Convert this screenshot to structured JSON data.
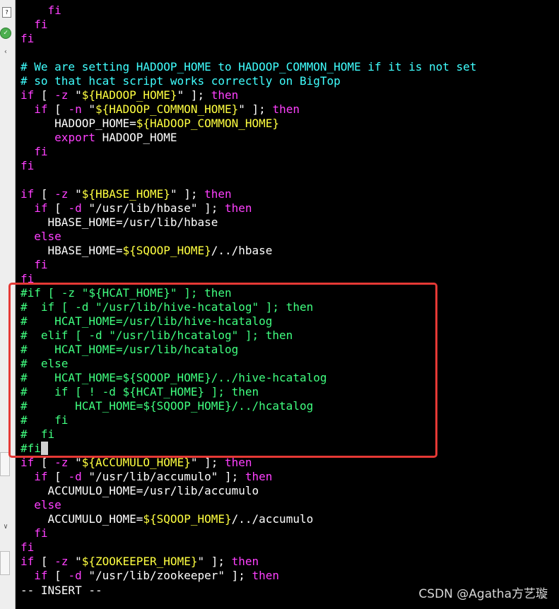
{
  "editor": {
    "mode_indicator": "-- INSERT --",
    "lines": [
      {
        "indent": "    ",
        "parts": [
          {
            "cls": "kw",
            "text": "fi"
          }
        ]
      },
      {
        "indent": "  ",
        "parts": [
          {
            "cls": "kw",
            "text": "fi"
          }
        ]
      },
      {
        "indent": "",
        "parts": [
          {
            "cls": "kw",
            "text": "fi"
          }
        ]
      },
      {
        "indent": "",
        "parts": []
      },
      {
        "indent": "",
        "parts": [
          {
            "cls": "comment",
            "text": "# We are setting HADOOP_HOME to HADOOP_COMMON_HOME if it is not set"
          }
        ]
      },
      {
        "indent": "",
        "parts": [
          {
            "cls": "comment",
            "text": "# so that hcat script works correctly on BigTop"
          }
        ]
      },
      {
        "indent": "",
        "parts": [
          {
            "cls": "kw",
            "text": "if"
          },
          {
            "cls": "code",
            "text": " [ "
          },
          {
            "cls": "kw",
            "text": "-z"
          },
          {
            "cls": "code",
            "text": " \""
          },
          {
            "cls": "var",
            "text": "${HADOOP_HOME}"
          },
          {
            "cls": "code",
            "text": "\" ]; "
          },
          {
            "cls": "kw",
            "text": "then"
          }
        ]
      },
      {
        "indent": "  ",
        "parts": [
          {
            "cls": "kw",
            "text": "if"
          },
          {
            "cls": "code",
            "text": " [ "
          },
          {
            "cls": "kw",
            "text": "-n"
          },
          {
            "cls": "code",
            "text": " \""
          },
          {
            "cls": "var",
            "text": "${HADOOP_COMMON_HOME}"
          },
          {
            "cls": "code",
            "text": "\" ]; "
          },
          {
            "cls": "kw",
            "text": "then"
          }
        ]
      },
      {
        "indent": "     ",
        "parts": [
          {
            "cls": "code",
            "text": "HADOOP_HOME="
          },
          {
            "cls": "var",
            "text": "${HADOOP_COMMON_HOME}"
          }
        ]
      },
      {
        "indent": "     ",
        "parts": [
          {
            "cls": "kw",
            "text": "export"
          },
          {
            "cls": "code",
            "text": " HADOOP_HOME"
          }
        ]
      },
      {
        "indent": "  ",
        "parts": [
          {
            "cls": "kw",
            "text": "fi"
          }
        ]
      },
      {
        "indent": "",
        "parts": [
          {
            "cls": "kw",
            "text": "fi"
          }
        ]
      },
      {
        "indent": "",
        "parts": []
      },
      {
        "indent": "",
        "parts": [
          {
            "cls": "kw",
            "text": "if"
          },
          {
            "cls": "code",
            "text": " [ "
          },
          {
            "cls": "kw",
            "text": "-z"
          },
          {
            "cls": "code",
            "text": " \""
          },
          {
            "cls": "var",
            "text": "${HBASE_HOME}"
          },
          {
            "cls": "code",
            "text": "\" ]; "
          },
          {
            "cls": "kw",
            "text": "then"
          }
        ]
      },
      {
        "indent": "  ",
        "parts": [
          {
            "cls": "kw",
            "text": "if"
          },
          {
            "cls": "code",
            "text": " [ "
          },
          {
            "cls": "kw",
            "text": "-d"
          },
          {
            "cls": "code",
            "text": " \"/usr/lib/hbase\" ]; "
          },
          {
            "cls": "kw",
            "text": "then"
          }
        ]
      },
      {
        "indent": "    ",
        "parts": [
          {
            "cls": "code",
            "text": "HBASE_HOME=/usr/lib/hbase"
          }
        ]
      },
      {
        "indent": "  ",
        "parts": [
          {
            "cls": "kw",
            "text": "else"
          }
        ]
      },
      {
        "indent": "    ",
        "parts": [
          {
            "cls": "code",
            "text": "HBASE_HOME="
          },
          {
            "cls": "var",
            "text": "${SQOOP_HOME}"
          },
          {
            "cls": "code",
            "text": "/../hbase"
          }
        ]
      },
      {
        "indent": "  ",
        "parts": [
          {
            "cls": "kw",
            "text": "fi"
          }
        ]
      },
      {
        "indent": "",
        "parts": [
          {
            "cls": "kw",
            "text": "fi"
          }
        ]
      },
      {
        "indent": "",
        "parts": [
          {
            "cls": "commented",
            "text": "#if [ -z \"${HCAT_HOME}\" ]; then"
          }
        ]
      },
      {
        "indent": "",
        "parts": [
          {
            "cls": "commented",
            "text": "#  if [ -d \"/usr/lib/hive-hcatalog\" ]; then"
          }
        ]
      },
      {
        "indent": "",
        "parts": [
          {
            "cls": "commented",
            "text": "#    HCAT_HOME=/usr/lib/hive-hcatalog"
          }
        ]
      },
      {
        "indent": "",
        "parts": [
          {
            "cls": "commented",
            "text": "#  elif [ -d \"/usr/lib/hcatalog\" ]; then"
          }
        ]
      },
      {
        "indent": "",
        "parts": [
          {
            "cls": "commented",
            "text": "#    HCAT_HOME=/usr/lib/hcatalog"
          }
        ]
      },
      {
        "indent": "",
        "parts": [
          {
            "cls": "commented",
            "text": "#  else"
          }
        ]
      },
      {
        "indent": "",
        "parts": [
          {
            "cls": "commented",
            "text": "#    HCAT_HOME=${SQOOP_HOME}/../hive-hcatalog"
          }
        ]
      },
      {
        "indent": "",
        "parts": [
          {
            "cls": "commented",
            "text": "#    if [ ! -d ${HCAT_HOME} ]; then"
          }
        ]
      },
      {
        "indent": "",
        "parts": [
          {
            "cls": "commented",
            "text": "#       HCAT_HOME=${SQOOP_HOME}/../hcatalog"
          }
        ]
      },
      {
        "indent": "",
        "parts": [
          {
            "cls": "commented",
            "text": "#    fi"
          }
        ]
      },
      {
        "indent": "",
        "parts": [
          {
            "cls": "commented",
            "text": "#  fi"
          }
        ]
      },
      {
        "indent": "",
        "parts": [
          {
            "cls": "commented",
            "text": "#fi"
          },
          {
            "cls": "cursor-cell",
            "text": " "
          }
        ]
      },
      {
        "indent": "",
        "parts": [
          {
            "cls": "kw",
            "text": "if"
          },
          {
            "cls": "code",
            "text": " [ "
          },
          {
            "cls": "kw",
            "text": "-z"
          },
          {
            "cls": "code",
            "text": " \""
          },
          {
            "cls": "var",
            "text": "${ACCUMULO_HOME}"
          },
          {
            "cls": "code",
            "text": "\" ]; "
          },
          {
            "cls": "kw",
            "text": "then"
          }
        ]
      },
      {
        "indent": "  ",
        "parts": [
          {
            "cls": "kw",
            "text": "if"
          },
          {
            "cls": "code",
            "text": " [ "
          },
          {
            "cls": "kw",
            "text": "-d"
          },
          {
            "cls": "code",
            "text": " \"/usr/lib/accumulo\" ]; "
          },
          {
            "cls": "kw",
            "text": "then"
          }
        ]
      },
      {
        "indent": "    ",
        "parts": [
          {
            "cls": "code",
            "text": "ACCUMULO_HOME=/usr/lib/accumulo"
          }
        ]
      },
      {
        "indent": "  ",
        "parts": [
          {
            "cls": "kw",
            "text": "else"
          }
        ]
      },
      {
        "indent": "    ",
        "parts": [
          {
            "cls": "code",
            "text": "ACCUMULO_HOME="
          },
          {
            "cls": "var",
            "text": "${SQOOP_HOME}"
          },
          {
            "cls": "code",
            "text": "/../accumulo"
          }
        ]
      },
      {
        "indent": "  ",
        "parts": [
          {
            "cls": "kw",
            "text": "fi"
          }
        ]
      },
      {
        "indent": "",
        "parts": [
          {
            "cls": "kw",
            "text": "fi"
          }
        ]
      },
      {
        "indent": "",
        "parts": [
          {
            "cls": "kw",
            "text": "if"
          },
          {
            "cls": "code",
            "text": " [ "
          },
          {
            "cls": "kw",
            "text": "-z"
          },
          {
            "cls": "code",
            "text": " \""
          },
          {
            "cls": "var",
            "text": "${ZOOKEEPER_HOME}"
          },
          {
            "cls": "code",
            "text": "\" ]; "
          },
          {
            "cls": "kw",
            "text": "then"
          }
        ]
      },
      {
        "indent": "  ",
        "parts": [
          {
            "cls": "kw",
            "text": "if"
          },
          {
            "cls": "code",
            "text": " [ "
          },
          {
            "cls": "kw",
            "text": "-d"
          },
          {
            "cls": "code",
            "text": " \"/usr/lib/zookeeper\" ]; "
          },
          {
            "cls": "kw",
            "text": "then"
          }
        ]
      }
    ]
  },
  "gutter": {
    "doc_icon_glyph": "?",
    "check_icon_glyph": "✓",
    "arrow_up_glyph": "‹",
    "arrow_down_glyph": "∨"
  },
  "watermark": {
    "text": "CSDN @Agatha方艺璇"
  },
  "colors": {
    "background": "#000000",
    "keyword": "#ff40ff",
    "variable": "#ffff40",
    "comment": "#40ffff",
    "commented_code": "#40ff80",
    "highlight_box": "#e53935"
  }
}
